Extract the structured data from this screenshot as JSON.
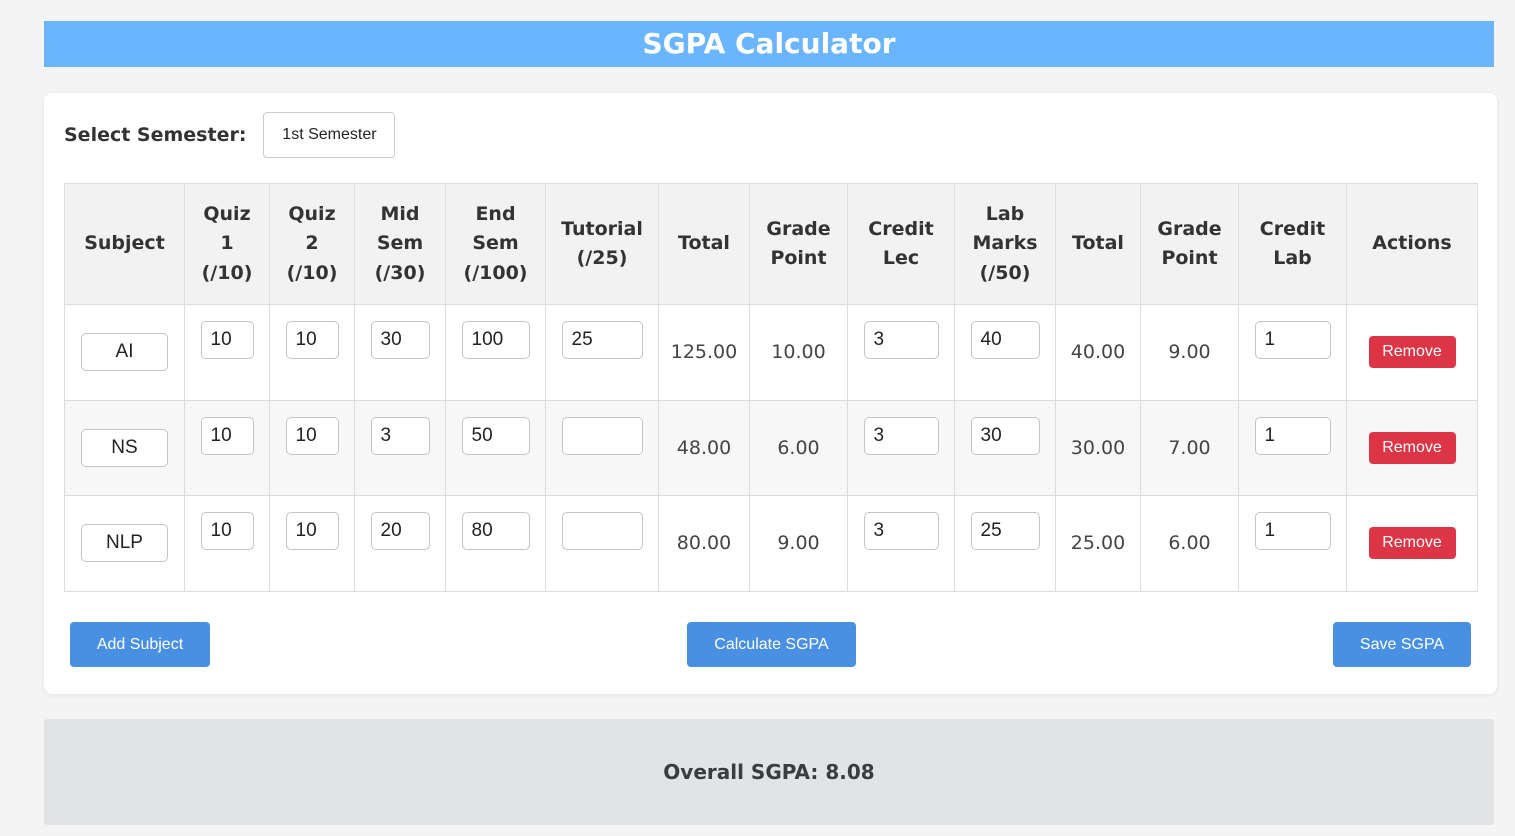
{
  "header": {
    "title": "SGPA Calculator"
  },
  "semester": {
    "label": "Select Semester:",
    "selected": "1st Semester"
  },
  "table": {
    "columns": [
      [
        "Subject"
      ],
      [
        "Quiz",
        "1",
        "(/10)"
      ],
      [
        "Quiz",
        "2",
        "(/10)"
      ],
      [
        "Mid",
        "Sem",
        "(/30)"
      ],
      [
        "End",
        "Sem",
        "(/100)"
      ],
      [
        "Tutorial",
        "(/25)"
      ],
      [
        "Total"
      ],
      [
        "Grade",
        "Point"
      ],
      [
        "Credit",
        "Lec"
      ],
      [
        "Lab",
        "Marks",
        "(/50)"
      ],
      [
        "Total"
      ],
      [
        "Grade",
        "Point"
      ],
      [
        "Credit",
        "Lab"
      ],
      [
        "Actions"
      ]
    ],
    "rows": [
      {
        "subject": "AI",
        "quiz1": "10",
        "quiz2": "10",
        "mid": "30",
        "end": "100",
        "tutorial": "25",
        "total": "125.00",
        "grade": "10.00",
        "credit_lec": "3",
        "lab_marks": "40",
        "lab_total": "40.00",
        "lab_grade": "9.00",
        "credit_lab": "1",
        "action": "Remove"
      },
      {
        "subject": "NS",
        "quiz1": "10",
        "quiz2": "10",
        "mid": "3",
        "end": "50",
        "tutorial": "",
        "total": "48.00",
        "grade": "6.00",
        "credit_lec": "3",
        "lab_marks": "30",
        "lab_total": "30.00",
        "lab_grade": "7.00",
        "credit_lab": "1",
        "action": "Remove"
      },
      {
        "subject": "NLP",
        "quiz1": "10",
        "quiz2": "10",
        "mid": "20",
        "end": "80",
        "tutorial": "",
        "total": "80.00",
        "grade": "9.00",
        "credit_lec": "3",
        "lab_marks": "25",
        "lab_total": "25.00",
        "lab_grade": "6.00",
        "credit_lab": "1",
        "action": "Remove"
      }
    ]
  },
  "buttons": {
    "add": "Add Subject",
    "calculate": "Calculate SGPA",
    "save": "Save SGPA"
  },
  "result": {
    "text": "Overall SGPA: 8.08"
  },
  "colors": {
    "banner": "#6bb5ff",
    "primary_button": "#4a90e2",
    "danger_button": "#dc3545"
  }
}
